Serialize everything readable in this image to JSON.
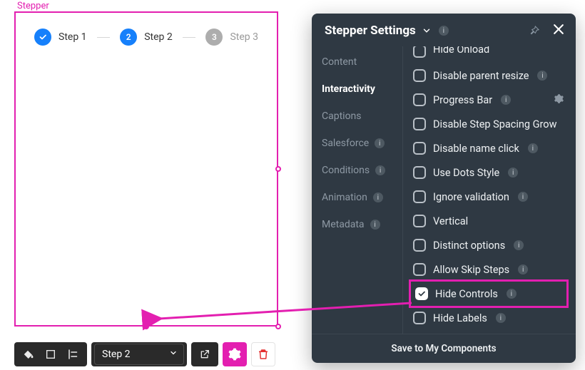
{
  "component_label": "Stepper",
  "steps": [
    {
      "label": "Step 1",
      "state": "done"
    },
    {
      "label": "Step 2",
      "state": "active",
      "num": "2"
    },
    {
      "label": "Step 3",
      "state": "pending",
      "num": "3"
    }
  ],
  "toolbar": {
    "selected_step": "Step 2"
  },
  "panel": {
    "title": "Stepper Settings",
    "footer": "Save to My Components",
    "tabs": [
      {
        "label": "Content",
        "active": false
      },
      {
        "label": "Interactivity",
        "active": true
      },
      {
        "label": "Captions",
        "active": false
      },
      {
        "label": "Salesforce",
        "active": false,
        "info": true
      },
      {
        "label": "Conditions",
        "active": false,
        "info": true
      },
      {
        "label": "Animation",
        "active": false,
        "info": true
      },
      {
        "label": "Metadata",
        "active": false,
        "info": true
      }
    ],
    "options": [
      {
        "label": "Hide Onload",
        "checked": false,
        "info": false,
        "partial": true
      },
      {
        "label": "Disable parent resize",
        "checked": false,
        "info": true
      },
      {
        "label": "Progress Bar",
        "checked": false,
        "info": true,
        "gear": true
      },
      {
        "label": "Disable Step Spacing Grow",
        "checked": false,
        "info": false
      },
      {
        "label": "Disable name click",
        "checked": false,
        "info": true
      },
      {
        "label": "Use Dots Style",
        "checked": false,
        "info": true
      },
      {
        "label": "Ignore validation",
        "checked": false,
        "info": true
      },
      {
        "label": "Vertical",
        "checked": false,
        "info": false
      },
      {
        "label": "Distinct options",
        "checked": false,
        "info": true
      },
      {
        "label": "Allow Skip Steps",
        "checked": false,
        "info": true
      },
      {
        "label": "Hide Controls",
        "checked": true,
        "info": true,
        "highlight": true
      },
      {
        "label": "Hide Labels",
        "checked": false,
        "info": true
      }
    ]
  },
  "colors": {
    "accent": "#e31fb0",
    "primary": "#1680fb",
    "panel": "#2f3943"
  }
}
